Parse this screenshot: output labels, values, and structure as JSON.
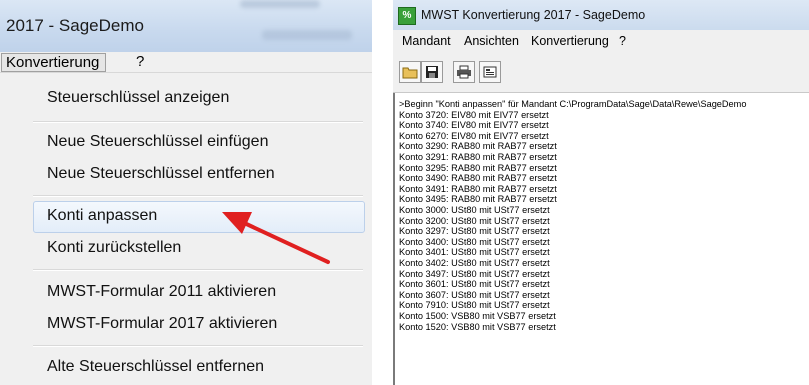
{
  "left": {
    "title": "2017 - SageDemo",
    "menubar": {
      "active_menu": "Konvertierung",
      "help": "?"
    },
    "menu_items": [
      "Steuerschlüssel anzeigen",
      "Neue Steuerschlüssel einfügen",
      "Neue Steuerschlüssel entfernen",
      "Konti anpassen",
      "Konti zurückstellen",
      "MWST-Formular 2011 aktivieren",
      "MWST-Formular 2017 aktivieren",
      "Alte Steuerschlüssel entfernen"
    ],
    "highlighted_item": "Konti anpassen",
    "arrow_color": "#e02020"
  },
  "right": {
    "title": "MWST Konvertierung 2017 - SageDemo",
    "menus": [
      "Mandant",
      "Ansichten",
      "Konvertierung",
      "?"
    ],
    "toolbar_icons": [
      "open-folder-icon",
      "save-icon",
      "print-icon",
      "properties-icon"
    ],
    "log_lines": [
      ">Beginn \"Konti anpassen\" für Mandant C:\\ProgramData\\Sage\\Data\\Rewe\\SageDemo",
      "Konto 3720: EIV80 mit EIV77 ersetzt",
      "Konto 3740: EIV80 mit EIV77 ersetzt",
      "Konto 6270: EIV80 mit EIV77 ersetzt",
      "Konto 3290: RAB80 mit RAB77 ersetzt",
      "Konto 3291: RAB80 mit RAB77 ersetzt",
      "Konto 3295: RAB80 mit RAB77 ersetzt",
      "Konto 3490: RAB80 mit RAB77 ersetzt",
      "Konto 3491: RAB80 mit RAB77 ersetzt",
      "Konto 3495: RAB80 mit RAB77 ersetzt",
      "Konto 3000: USt80 mit USt77 ersetzt",
      "Konto 3200: USt80 mit USt77 ersetzt",
      "Konto 3297: USt80 mit USt77 ersetzt",
      "Konto 3400: USt80 mit USt77 ersetzt",
      "Konto 3401: USt80 mit USt77 ersetzt",
      "Konto 3402: USt80 mit USt77 ersetzt",
      "Konto 3497: USt80 mit USt77 ersetzt",
      "Konto 3601: USt80 mit USt77 ersetzt",
      "Konto 3607: USt80 mit USt77 ersetzt",
      "Konto 7910: USt80 mit USt77 ersetzt",
      "Konto 1500: VSB80 mit VSB77 ersetzt",
      "Konto 1520: VSB80 mit VSB77 ersetzt"
    ]
  }
}
